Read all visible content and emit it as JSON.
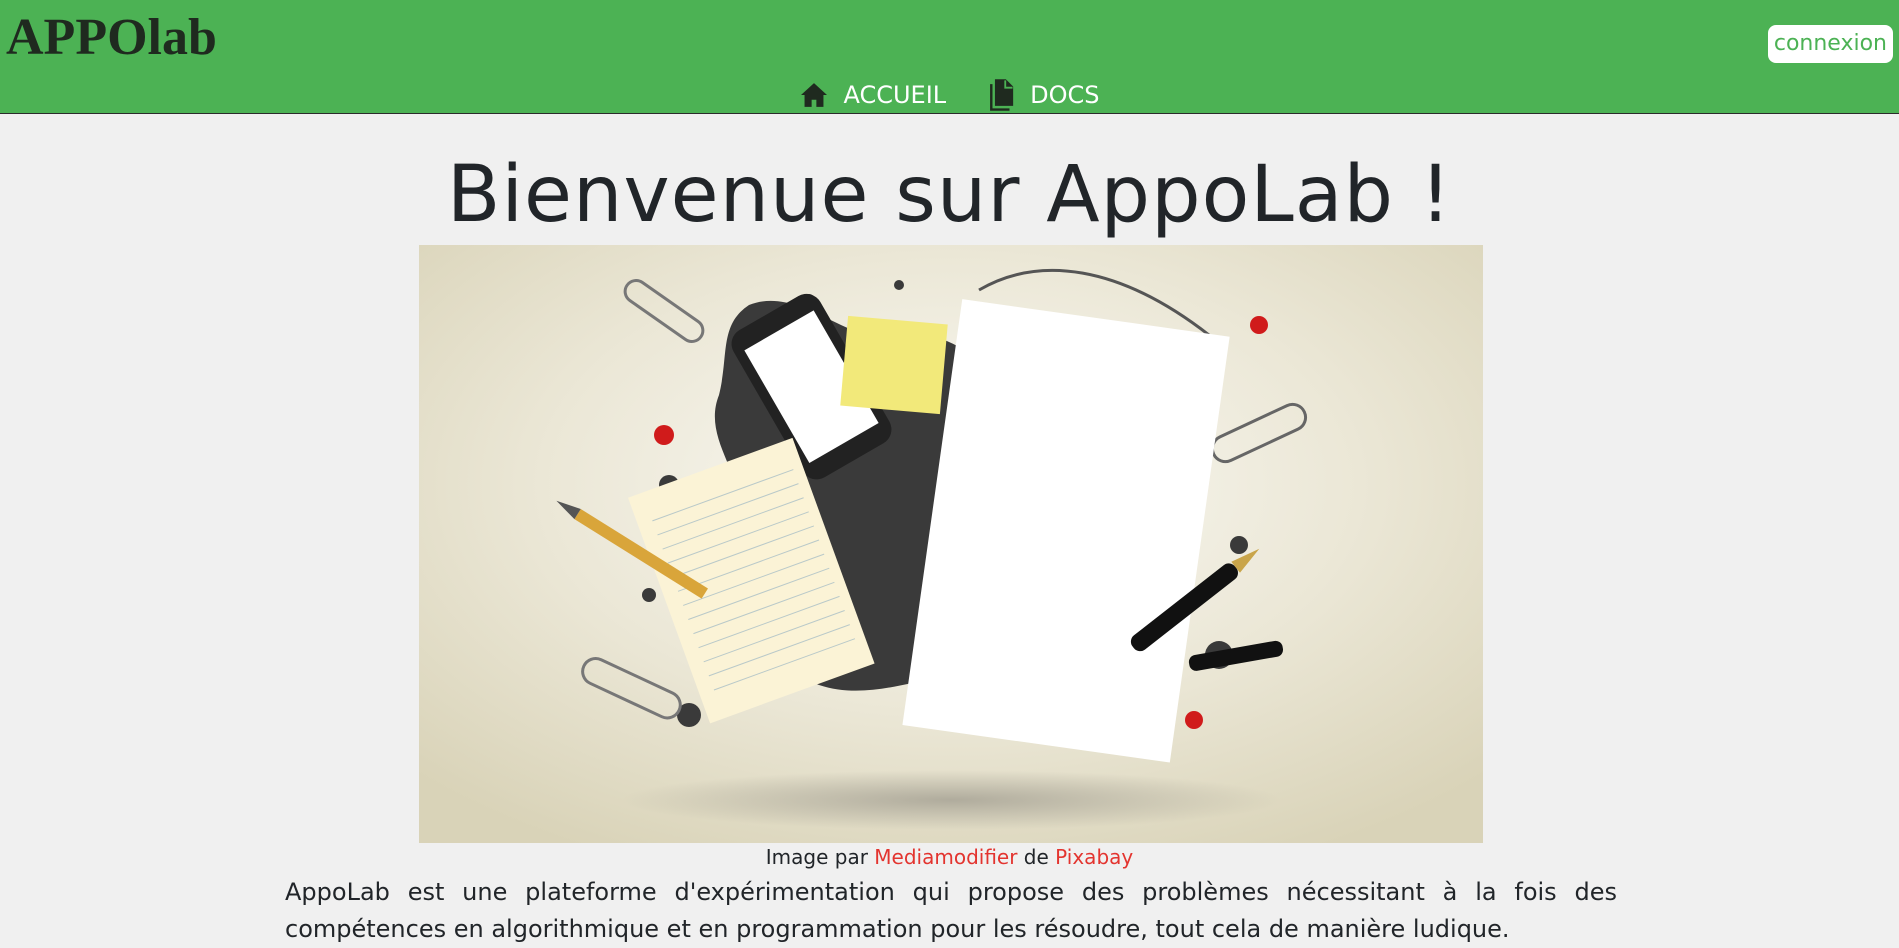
{
  "header": {
    "logo": "APPOlab",
    "login_label": "connexion",
    "nav": [
      {
        "label": "ACCUEIL",
        "icon": "home-icon"
      },
      {
        "label": "DOCS",
        "icon": "documents-icon"
      }
    ]
  },
  "main": {
    "title": "Bienvenue sur AppoLab !",
    "caption": {
      "prefix": "Image par ",
      "author": "Mediamodifier",
      "middle": " de ",
      "source": "Pixabay"
    },
    "intro": "AppoLab est une plateforme d'expérimentation qui propose des problèmes nécessitant à la fois des compétences en algorithmique et en programmation pour les résoudre, tout cela de manière ludique."
  },
  "colors": {
    "header_bg": "#4cb254",
    "link": "#e3342f",
    "page_bg": "#f0f0f0"
  }
}
